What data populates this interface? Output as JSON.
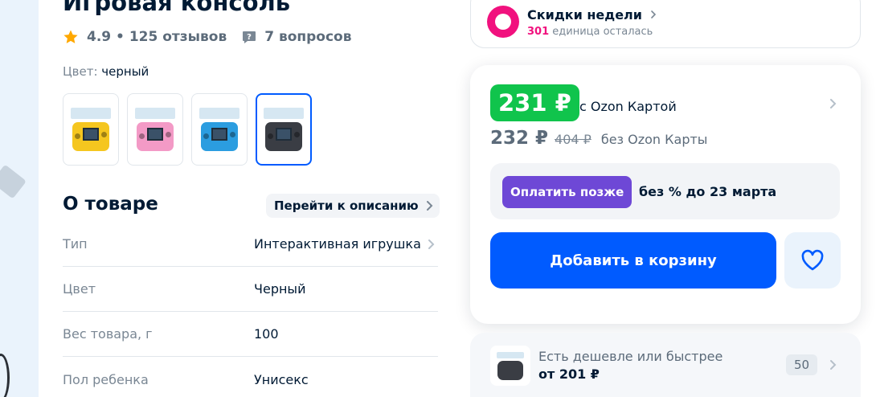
{
  "product": {
    "title": "Игровая консоль",
    "rating": "4.9 • 125 отзывов",
    "questions": "7 вопросов",
    "color_label": "Цвет: ",
    "color_value": "черный",
    "thumbnails": [
      {
        "color": "#f5c61f",
        "label": "yellow"
      },
      {
        "color": "#f39ac6",
        "label": "pink"
      },
      {
        "color": "#2b9de0",
        "label": "blue"
      },
      {
        "color": "#3a3d44",
        "label": "black",
        "selected": true
      }
    ]
  },
  "about": {
    "heading": "О товаре",
    "goto_label": "Перейти к описанию",
    "specs": [
      {
        "key": "Тип",
        "value": "Интерактивная игрушка"
      },
      {
        "key": "Цвет",
        "value": "Черный"
      },
      {
        "key": "Вес товара, г",
        "value": "100"
      },
      {
        "key": "Пол ребенка",
        "value": "Унисекс"
      }
    ]
  },
  "promo": {
    "title": "Скидки недели",
    "count": "301",
    "count_suffix": " единица осталась"
  },
  "pricing": {
    "card_price": "231 ₽",
    "card_label": "с Ozon Картой",
    "regular_price": "232 ₽",
    "old_price": "404 ₽",
    "no_card_label": "без Ozon Карты",
    "paylater_button": "Оплатить позже",
    "paylater_text": "без % до 23 марта",
    "add_to_cart": "Добавить в корзину"
  },
  "cheaper": {
    "title": "Есть дешевле или быстрее",
    "price": "от 201 ₽",
    "count": "50"
  },
  "colors": {
    "accent": "#005bff",
    "green": "#10c44c",
    "purple": "#6e48d6",
    "pink": "#f1117e"
  }
}
